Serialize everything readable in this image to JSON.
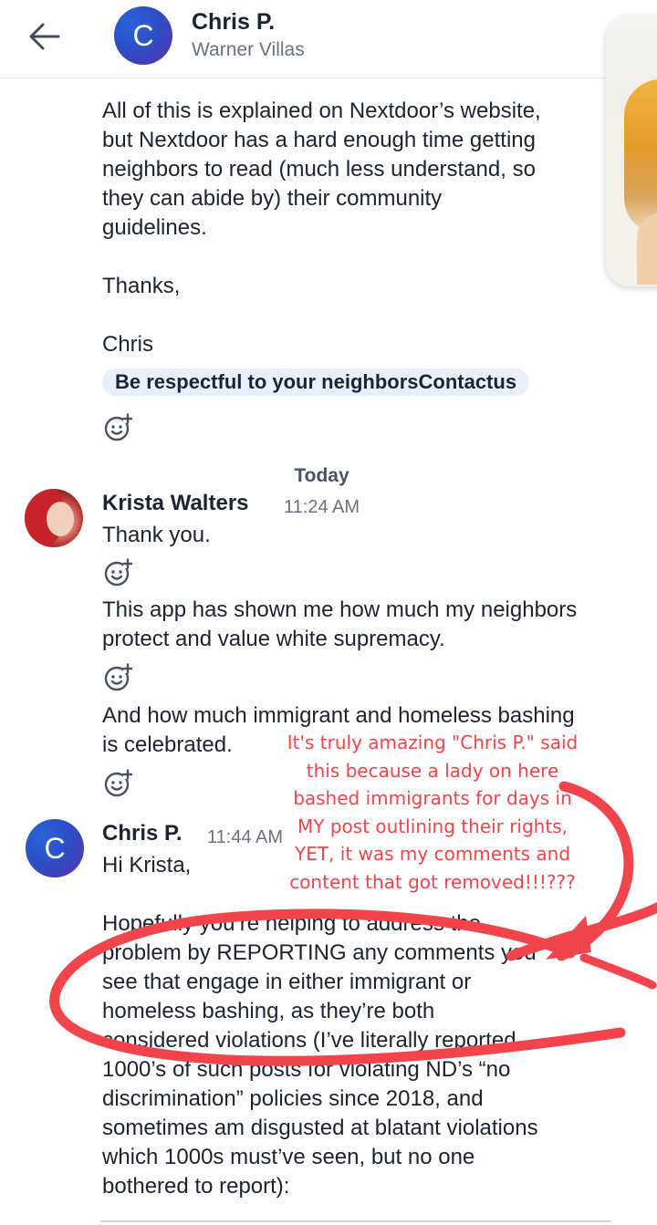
{
  "header": {
    "back_icon": "arrow-left-icon",
    "avatar_letter": "C",
    "name": "Chris P.",
    "subtitle": "Warner Villas"
  },
  "colors": {
    "avatar_gradient_start": "#2a63d9",
    "avatar_gradient_end": "#5a2fa8",
    "annotation_red": "#f2454b",
    "tag_background": "#eaf0fb"
  },
  "thread": {
    "prev_message": {
      "text": "All of this is explained on Nextdoor’s website,\nbut Nextdoor has a hard enough time getting\nneighbors to read (much less understand, so\nthey can abide by) their community\nguidelines.\n\nThanks,\n\nChris",
      "tag": "Be respectful to your neighborsContactus",
      "reaction_icon": "add-reaction-icon"
    },
    "day_divider": "Today",
    "krista": {
      "name": "Krista Walters",
      "time": "11:24 AM",
      "messages": [
        "Thank you.",
        "This app has shown me how much my neighbors\nprotect and value white supremacy.",
        "And how much immigrant and homeless bashing\nis celebrated."
      ]
    },
    "chris": {
      "avatar_letter": "C",
      "name": "Chris P.",
      "time": "11:44 AM",
      "text": "Hi Krista,\n\nHopefully you’re helping to address the\nproblem by REPORTING any comments you\nsee that engage in either immigrant or\nhomeless bashing, as they’re both\nconsidered violations (I’ve literally reported\n1000’s of such posts for violating ND’s “no\ndiscrimination” policies since 2018, and\nsometimes am disgusted at blatant violations\nwhich 1000s must’ve seen, but no one\nbothered to report):"
    }
  },
  "annotation": {
    "text": "It's truly amazing \"Chris P.\" said\nthis because a lady on here\nbashed immigrants for days in\nMY post outlining their rights,\nYET, it was my comments and\ncontent that got removed!!!???"
  }
}
